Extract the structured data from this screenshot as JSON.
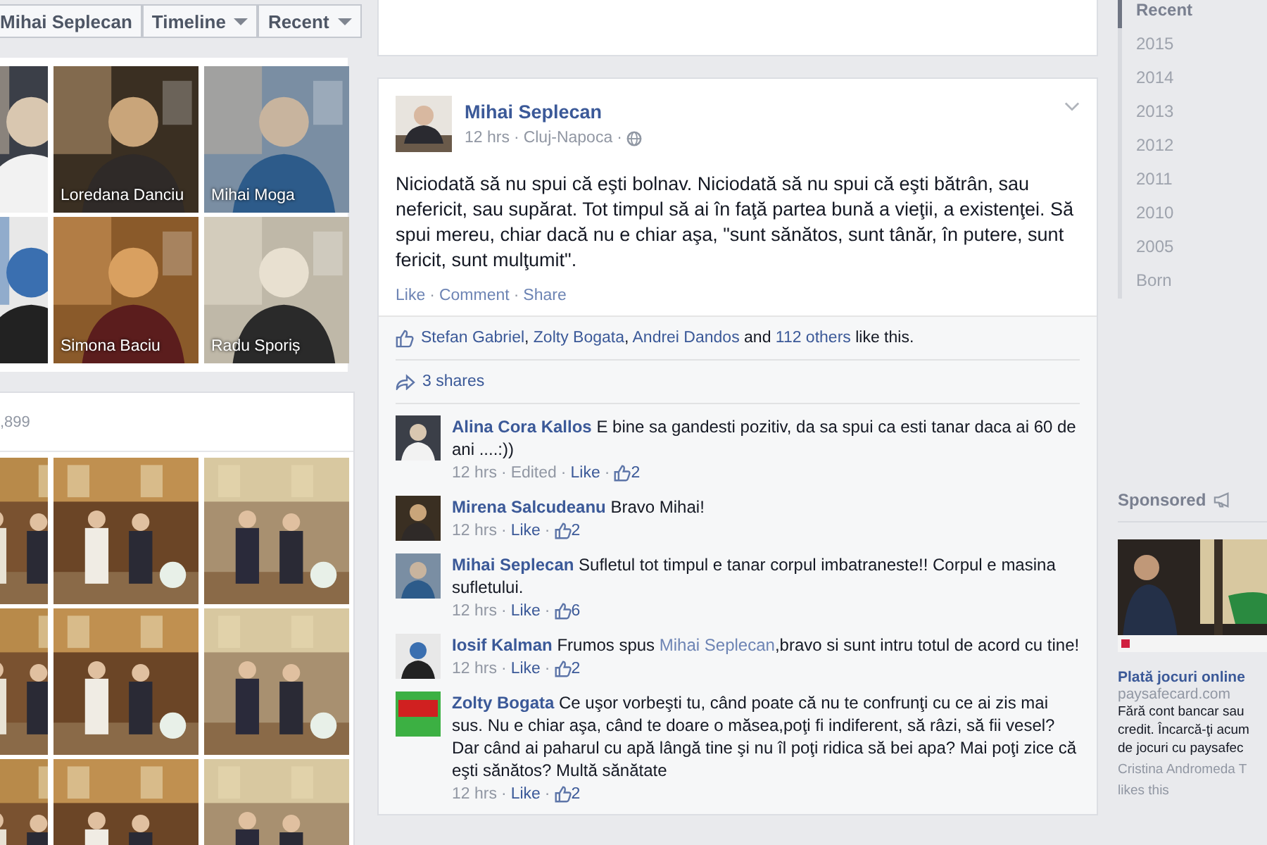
{
  "header": {
    "buttons": [
      {
        "label": "Mihai Seplecan",
        "dropdown": false
      },
      {
        "label": "Timeline",
        "dropdown": true
      },
      {
        "label": "Recent",
        "dropdown": true
      }
    ]
  },
  "friends": [
    {
      "kind": "picture"
    },
    {
      "kind": "picture",
      "name": "Loredana Danciu"
    },
    {
      "kind": "picture",
      "name": "Mihai Moga"
    },
    {
      "kind": "picture"
    },
    {
      "kind": "picture",
      "name": "Simona Baciu"
    },
    {
      "kind": "picture",
      "name": "Radu Sporiș"
    }
  ],
  "photos": {
    "count": ",899",
    "tiles": [
      {
        "kind": "picture"
      },
      {
        "kind": "picture"
      },
      {
        "kind": "picture"
      },
      {
        "kind": "picture"
      },
      {
        "kind": "picture"
      },
      {
        "kind": "picture"
      },
      {
        "kind": "picture"
      },
      {
        "kind": "picture"
      },
      {
        "kind": "picture"
      }
    ]
  },
  "post": {
    "author": "Mihai Seplecan",
    "time": "12 hrs",
    "location": "Cluj-Napoca",
    "text": "Niciodată să nu spui că eşti bolnav. Niciodată să nu spui că eşti bătrân, sau nefericit, sau supărat. Tot timpul să ai în faţă partea bună a vieţii, a existenţei. Să spui mereu, chiar dacă nu e chiar aşa, \"sunt sănătos, sunt tânăr, în putere, sunt fericit, sunt mulţumit\".",
    "actions": [
      "Like",
      "Comment",
      "Share"
    ],
    "separator": "·",
    "likes": {
      "names": [
        "Stefan Gabriel",
        "Zolty Bogata",
        "Andrei Dandos"
      ],
      "joiner": ", ",
      "and": "and",
      "others": "112 others",
      "tail": "like this."
    },
    "shares": "3 shares",
    "comments": [
      {
        "author": "Alina Cora Kallos",
        "text": "E bine sa gandesti pozitiv, da sa spui ca esti tanar daca ai 60 de ani ....:))",
        "time": "12 hrs",
        "edited": "Edited",
        "like": "Like",
        "likes": "2"
      },
      {
        "author": "Mirena Salcudeanu",
        "text": "Bravo Mihai!",
        "time": "12 hrs",
        "like": "Like",
        "likes": "2"
      },
      {
        "author": "Mihai Seplecan",
        "text": "Sufletul tot timpul e tanar corpul imbatraneste!! Corpul e masina sufletului.",
        "time": "12 hrs",
        "like": "Like",
        "likes": "6"
      },
      {
        "author": "Iosif Kalman",
        "text": "Frumos spus ",
        "mention": "Mihai Seplecan",
        "text_after": ",bravo si sunt intru totul de acord cu tine!",
        "time": "12 hrs",
        "like": "Like",
        "likes": "2"
      },
      {
        "author": "Zolty Bogata",
        "text": "Ce uşor vorbeşti tu, când poate că nu te confrunţi cu ce ai zis mai sus. Nu e chiar aşa, când te doare o măsea,poţi fi indiferent, să râzi, să fii vesel? Dar când ai paharul cu apă lângă tine şi nu îl poţi ridica să bei apa? Mai poţi zice că eşti sănătos? Multă sănătate",
        "time": "12 hrs",
        "like": "Like",
        "likes": "2"
      }
    ]
  },
  "timeline_nav": [
    {
      "label": "Recent",
      "selected": true
    },
    {
      "label": "2015",
      "selected": false
    },
    {
      "label": "2014",
      "selected": false
    },
    {
      "label": "2013",
      "selected": false
    },
    {
      "label": "2012",
      "selected": false
    },
    {
      "label": "2011",
      "selected": false
    },
    {
      "label": "2010",
      "selected": false
    },
    {
      "label": "2005",
      "selected": false
    },
    {
      "label": "Born",
      "selected": false
    }
  ],
  "sponsored": {
    "label": "Sponsored",
    "ad": {
      "kind": "picture",
      "title": "Plată jocuri online",
      "domain": "paysafecard.com",
      "lines": [
        "Fără cont bancar sau",
        "credit. Încarcă-ţi acum",
        "de jocuri cu paysafec"
      ],
      "social": "Cristina Andromeda T",
      "social_tail": "likes this"
    }
  }
}
